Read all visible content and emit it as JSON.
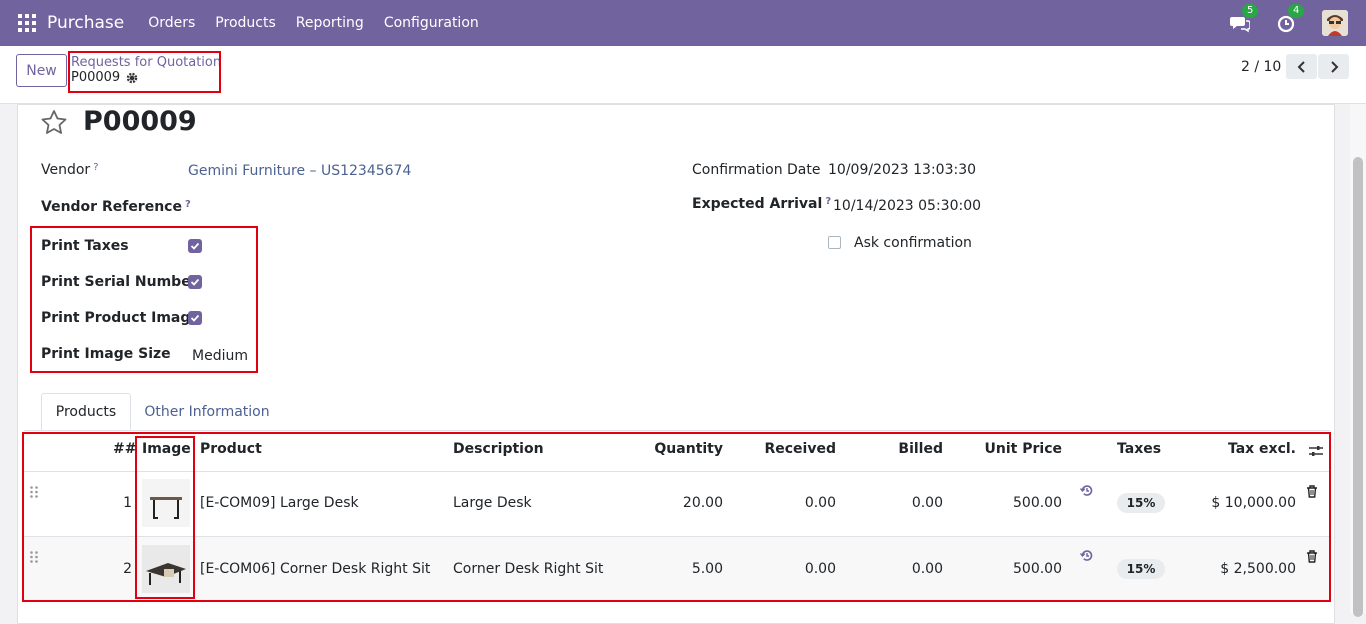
{
  "nav": {
    "brand": "Purchase",
    "menus": [
      "Orders",
      "Products",
      "Reporting",
      "Configuration"
    ],
    "chat_count": "5",
    "activity_count": "4"
  },
  "control": {
    "new_label": "New",
    "breadcrumb_parent": "Requests for Quotation",
    "breadcrumb_current": "P00009",
    "pager": "2 / 10"
  },
  "record": {
    "title": "P00009",
    "vendor_label": "Vendor",
    "vendor": "Gemini Furniture – US12345674",
    "vendor_ref_label": "Vendor Reference",
    "print_taxes_label": "Print Taxes",
    "print_taxes": true,
    "print_serial_label": "Print Serial Number",
    "print_serial": true,
    "print_image_label": "Print Product Image",
    "print_image": true,
    "print_image_size_label": "Print Image Size",
    "print_image_size": "Medium",
    "confirmation_date_label": "Confirmation Date",
    "confirmation_date": "10/09/2023 13:03:30",
    "expected_arrival_label": "Expected Arrival",
    "expected_arrival": "10/14/2023 05:30:00",
    "ask_confirmation_label": "Ask confirmation",
    "help_mark": "?"
  },
  "tabs": [
    "Products",
    "Other Information"
  ],
  "table": {
    "headers": [
      "##",
      "Image",
      "Product",
      "Description",
      "Quantity",
      "Received",
      "Billed",
      "Unit Price",
      "Taxes",
      "Tax excl."
    ],
    "rows": [
      {
        "no": "1",
        "product": "[E-COM09] Large Desk",
        "description": "Large Desk",
        "quantity": "20.00",
        "received": "0.00",
        "billed": "0.00",
        "unit_price": "500.00",
        "taxes": "15%",
        "tax_excl": "$ 10,000.00"
      },
      {
        "no": "2",
        "product": "[E-COM06] Corner Desk Right Sit",
        "description": "Corner Desk Right Sit",
        "quantity": "5.00",
        "received": "0.00",
        "billed": "0.00",
        "unit_price": "500.00",
        "taxes": "15%",
        "tax_excl": "$ 2,500.00"
      }
    ]
  },
  "colors": {
    "brand": "#71639e",
    "highlight": "#e00010",
    "badge": "#28a745"
  }
}
